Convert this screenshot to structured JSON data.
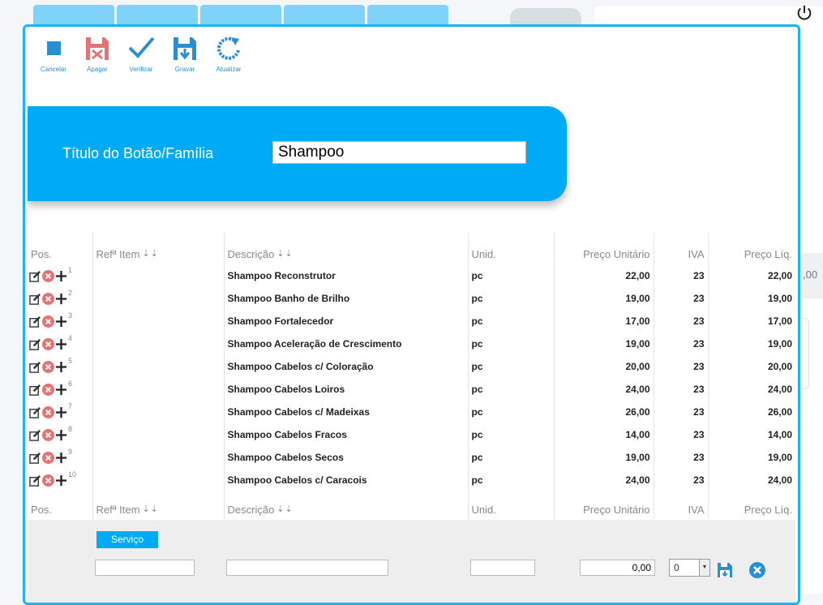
{
  "toolbar": [
    {
      "label": "Cancelar",
      "icon": "square-icon"
    },
    {
      "label": "Apagar",
      "icon": "delete-disk-icon"
    },
    {
      "label": "Verificar",
      "icon": "check-icon"
    },
    {
      "label": "Gravar",
      "icon": "save-icon"
    },
    {
      "label": "Atualizar",
      "icon": "refresh-icon"
    }
  ],
  "header": {
    "label": "Título do Botão/Família",
    "value": "Shampoo"
  },
  "columns": [
    "Pos.",
    "Refª Item",
    "Descrição",
    "Unid.",
    "Preço Unitário",
    "IVA",
    "Preço Líq."
  ],
  "rows": [
    {
      "pos": "1",
      "ref": "",
      "desc": "Shampoo Reconstrutor",
      "unit": "pc",
      "price": "22,00",
      "iva": "23",
      "net": "22,00"
    },
    {
      "pos": "2",
      "ref": "",
      "desc": "Shampoo Banho de Brilho",
      "unit": "pc",
      "price": "19,00",
      "iva": "23",
      "net": "19,00"
    },
    {
      "pos": "3",
      "ref": "",
      "desc": "Shampoo Fortalecedor",
      "unit": "pc",
      "price": "17,00",
      "iva": "23",
      "net": "17,00"
    },
    {
      "pos": "4",
      "ref": "",
      "desc": "Shampoo Aceleração de Crescimento",
      "unit": "pc",
      "price": "19,00",
      "iva": "23",
      "net": "19,00"
    },
    {
      "pos": "5",
      "ref": "",
      "desc": "Shampoo Cabelos c/ Coloração",
      "unit": "pc",
      "price": "20,00",
      "iva": "23",
      "net": "20,00"
    },
    {
      "pos": "6",
      "ref": "",
      "desc": "Shampoo Cabelos Loiros",
      "unit": "pc",
      "price": "24,00",
      "iva": "23",
      "net": "24,00"
    },
    {
      "pos": "7",
      "ref": "",
      "desc": "Shampoo Cabelos c/ Madeixas",
      "unit": "pc",
      "price": "26,00",
      "iva": "23",
      "net": "26,00"
    },
    {
      "pos": "8",
      "ref": "",
      "desc": "Shampoo Cabelos Fracos",
      "unit": "pc",
      "price": "14,00",
      "iva": "23",
      "net": "14,00"
    },
    {
      "pos": "9",
      "ref": "",
      "desc": "Shampoo Cabelos Secos",
      "unit": "pc",
      "price": "19,00",
      "iva": "23",
      "net": "19,00"
    },
    {
      "pos": "10",
      "ref": "",
      "desc": "Shampoo Cabelos c/ Caracois",
      "unit": "pc",
      "price": "24,00",
      "iva": "23",
      "net": "24,00"
    }
  ],
  "entry": {
    "service_label": "Serviço",
    "price_value": "0,00",
    "iva_selected": "0"
  },
  "background": {
    "partial_value": ",00"
  },
  "colors": {
    "accent": "#00aaf5",
    "border": "#1ab4f5",
    "delete": "#e57373"
  }
}
